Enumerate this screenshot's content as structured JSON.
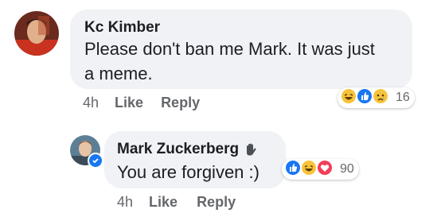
{
  "comment": {
    "author": "Kc Kimber",
    "text_line1": "Please don't ban me Mark. It was just",
    "text_line2": "a meme.",
    "time": "4h",
    "like_label": "Like",
    "reply_label": "Reply",
    "reactions": [
      "haha-icon",
      "like-icon",
      "sad-icon"
    ],
    "reaction_count": "16"
  },
  "reply": {
    "author": "Mark Zuckerberg",
    "author_badge": "wave-icon",
    "verified_badge": "verified-icon",
    "text": "You are forgiven :)",
    "time": "4h",
    "like_label": "Like",
    "reply_label": "Reply",
    "reactions": [
      "like-icon",
      "haha-icon",
      "love-icon"
    ],
    "reaction_count": "90"
  },
  "colors": {
    "bubble": "#f0f2f5",
    "like_blue": "#1877f2",
    "haha_yellow": "#f7c33b",
    "love_red": "#f33e58",
    "meta_gray": "#65676b"
  }
}
